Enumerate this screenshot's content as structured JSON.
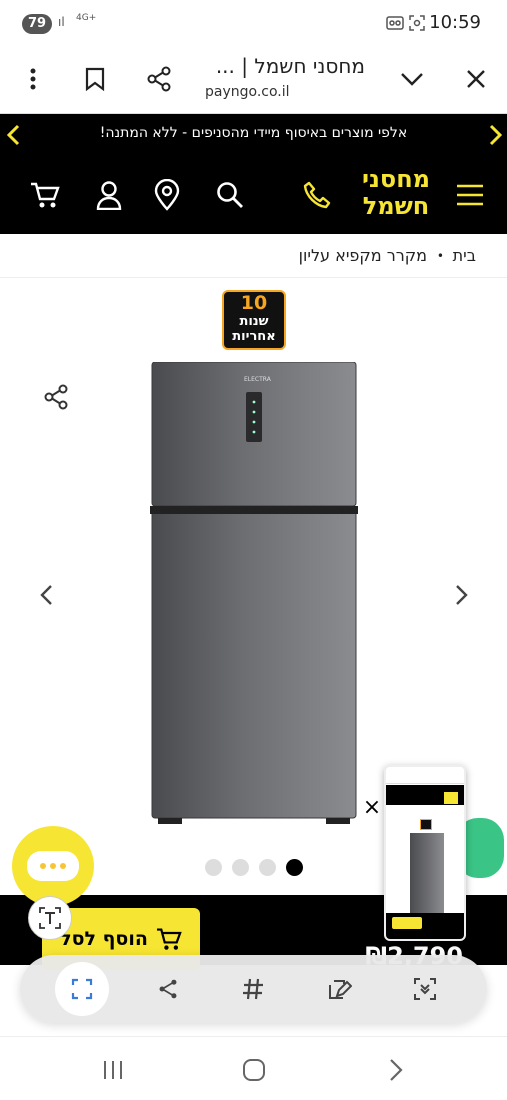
{
  "status_bar": {
    "battery": "79",
    "network": "4G+",
    "time": "10:59"
  },
  "browser": {
    "title": "מחסני חשמל | ...",
    "url": "payngo.co.il"
  },
  "promo": {
    "text": "אלפי מוצרים באיסוף מיידי מהסניפים - ללא המתנה!"
  },
  "logo": {
    "line1": "מחסני",
    "line2": "חשמל",
    "color": "#f7e533"
  },
  "breadcrumb": {
    "home": "בית",
    "separator": "•",
    "current": "מקרר מקפיא עליון"
  },
  "product": {
    "warranty_number": "10",
    "warranty_line1": "שנות",
    "warranty_line2": "אחריות",
    "brand_label": "ELECTRA",
    "carousel_total": 4,
    "carousel_active_index": 3
  },
  "purchase": {
    "add_to_cart": "הוסף לסל",
    "price_label": ":",
    "price": "₪2,790"
  },
  "icons": [
    "cart-icon",
    "user-icon",
    "location-icon",
    "search-icon",
    "phone-icon",
    "menu-icon",
    "share-icon",
    "bookmark-icon",
    "more-icon",
    "close-icon",
    "chevron-down-icon"
  ],
  "colors": {
    "accent": "#f7e533",
    "header_bg": "#000000"
  }
}
